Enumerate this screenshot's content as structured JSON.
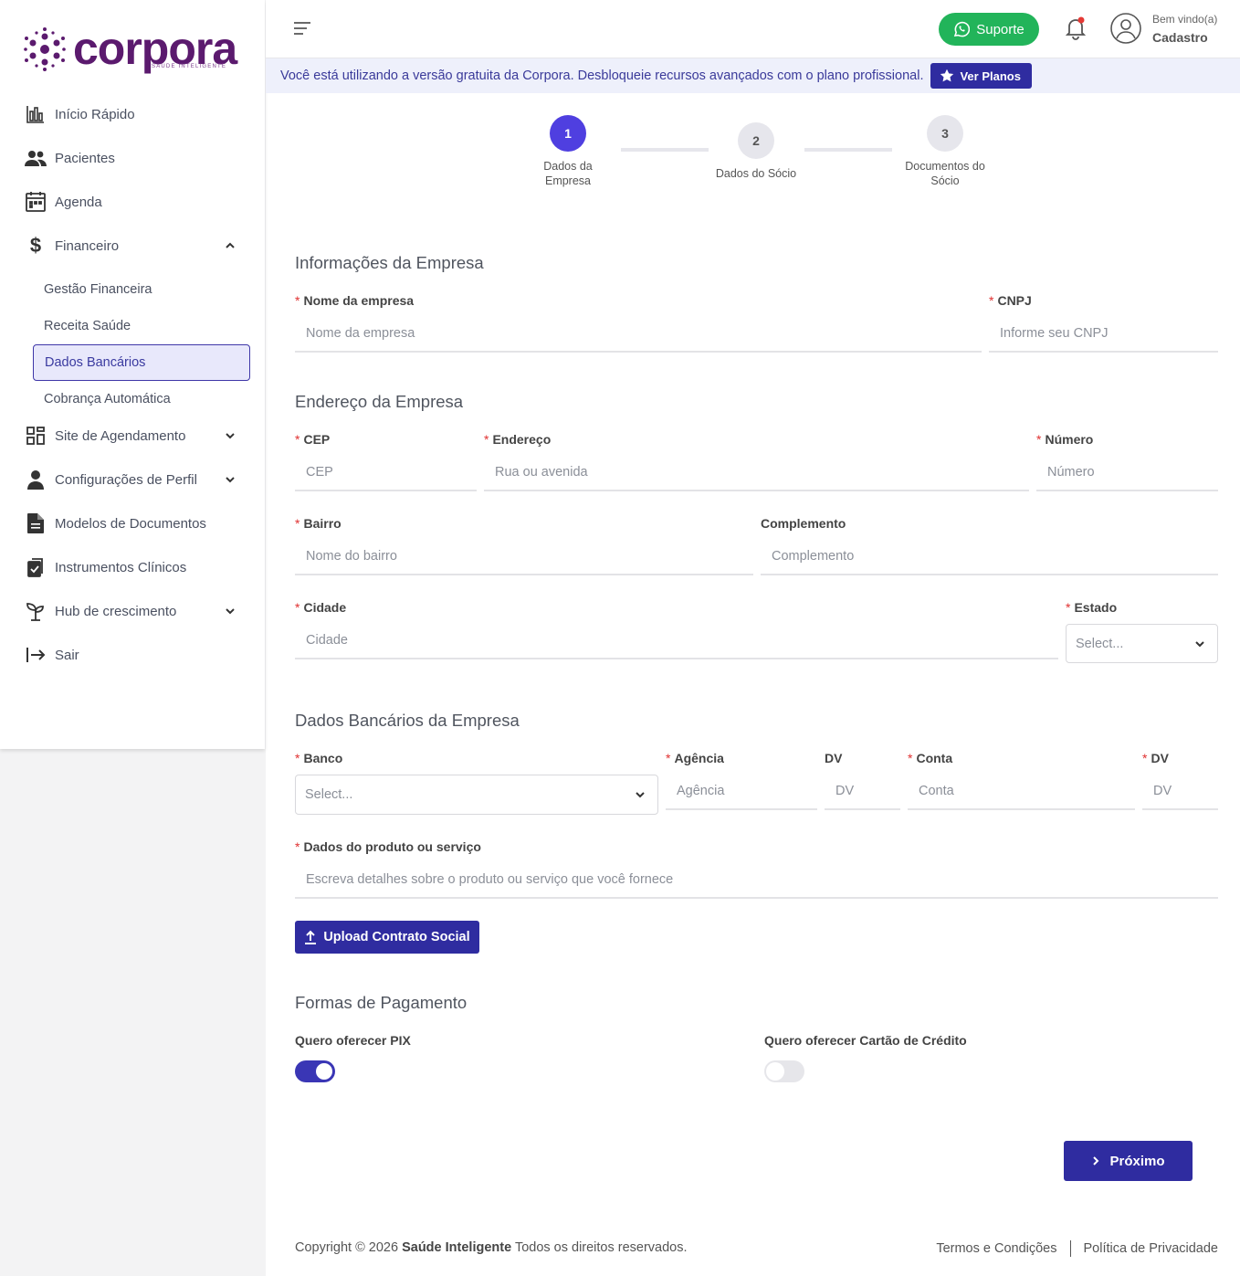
{
  "brand": {
    "name": "corpora",
    "tagline": "SAÚDE INTELIGENTE",
    "color": "#5b1a6e"
  },
  "sidebar": {
    "items": [
      {
        "label": "Início Rápido",
        "icon": "bar-chart-icon"
      },
      {
        "label": "Pacientes",
        "icon": "users-icon"
      },
      {
        "label": "Agenda",
        "icon": "calendar-icon"
      },
      {
        "label": "Financeiro",
        "icon": "dollar-icon",
        "expanded": true
      },
      {
        "label": "Site de Agendamento",
        "icon": "grid-icon"
      },
      {
        "label": "Configurações de Perfil",
        "icon": "person-icon"
      },
      {
        "label": "Modelos de Documentos",
        "icon": "document-icon"
      },
      {
        "label": "Instrumentos Clínicos",
        "icon": "clipboard-icon"
      },
      {
        "label": "Hub de crescimento",
        "icon": "sprout-icon"
      },
      {
        "label": "Sair",
        "icon": "logout-icon"
      }
    ],
    "financeiro_sub": [
      {
        "label": "Gestão Financeira"
      },
      {
        "label": "Receita Saúde"
      },
      {
        "label": "Dados Bancários",
        "active": true
      },
      {
        "label": "Cobrança Automática"
      }
    ]
  },
  "header": {
    "support_label": "Suporte",
    "welcome": "Bem vindo(a)",
    "username": "Cadastro",
    "support_color": "#22b45a"
  },
  "banner": {
    "text": "Você está utilizando a versão gratuita da Corpora. Desbloqueie recursos avançados com o plano profissional.",
    "button": "Ver Planos"
  },
  "stepper": {
    "steps": [
      {
        "number": "1",
        "label": "Dados da Empresa",
        "active": true
      },
      {
        "number": "2",
        "label": "Dados do Sócio",
        "active": false
      },
      {
        "number": "3",
        "label": "Documentos do Sócio",
        "active": false
      }
    ]
  },
  "form": {
    "company_section": "Informações da Empresa",
    "company_name": {
      "label": "Nome da empresa",
      "placeholder": "Nome da empresa"
    },
    "cnpj": {
      "label": "CNPJ",
      "placeholder": "Informe seu CNPJ"
    },
    "address_section": "Endereço da Empresa",
    "cep": {
      "label": "CEP",
      "placeholder": "CEP"
    },
    "endereco": {
      "label": "Endereço",
      "placeholder": "Rua ou avenida"
    },
    "numero": {
      "label": "Número",
      "placeholder": "Número"
    },
    "bairro": {
      "label": "Bairro",
      "placeholder": "Nome do bairro"
    },
    "complemento": {
      "label": "Complemento",
      "placeholder": "Complemento"
    },
    "cidade": {
      "label": "Cidade",
      "placeholder": "Cidade"
    },
    "estado": {
      "label": "Estado",
      "value": "Select..."
    },
    "bank_section": "Dados Bancários da Empresa",
    "banco": {
      "label": "Banco",
      "value": "Select..."
    },
    "agencia": {
      "label": "Agência",
      "placeholder": "Agência"
    },
    "agencia_dv": {
      "label": "DV",
      "placeholder": "DV"
    },
    "conta": {
      "label": "Conta",
      "placeholder": "Conta"
    },
    "conta_dv": {
      "label": "DV",
      "placeholder": "DV"
    },
    "produto": {
      "label": "Dados do produto ou serviço",
      "placeholder": "Escreva detalhes sobre o produto ou serviço que você fornece"
    },
    "upload_label": "Upload Contrato Social",
    "payment_section": "Formas de Pagamento",
    "pix": {
      "label": "Quero oferecer PIX",
      "enabled": true
    },
    "card": {
      "label": "Quero oferecer Cartão de Crédito",
      "enabled": false
    },
    "next_label": "Próximo"
  },
  "footer": {
    "copyright_prefix": "Copyright © 2026",
    "company": "Saúde Inteligente",
    "rights": "Todos os direitos reservados.",
    "terms": "Termos e Condições",
    "privacy": "Política de Privacidade"
  }
}
